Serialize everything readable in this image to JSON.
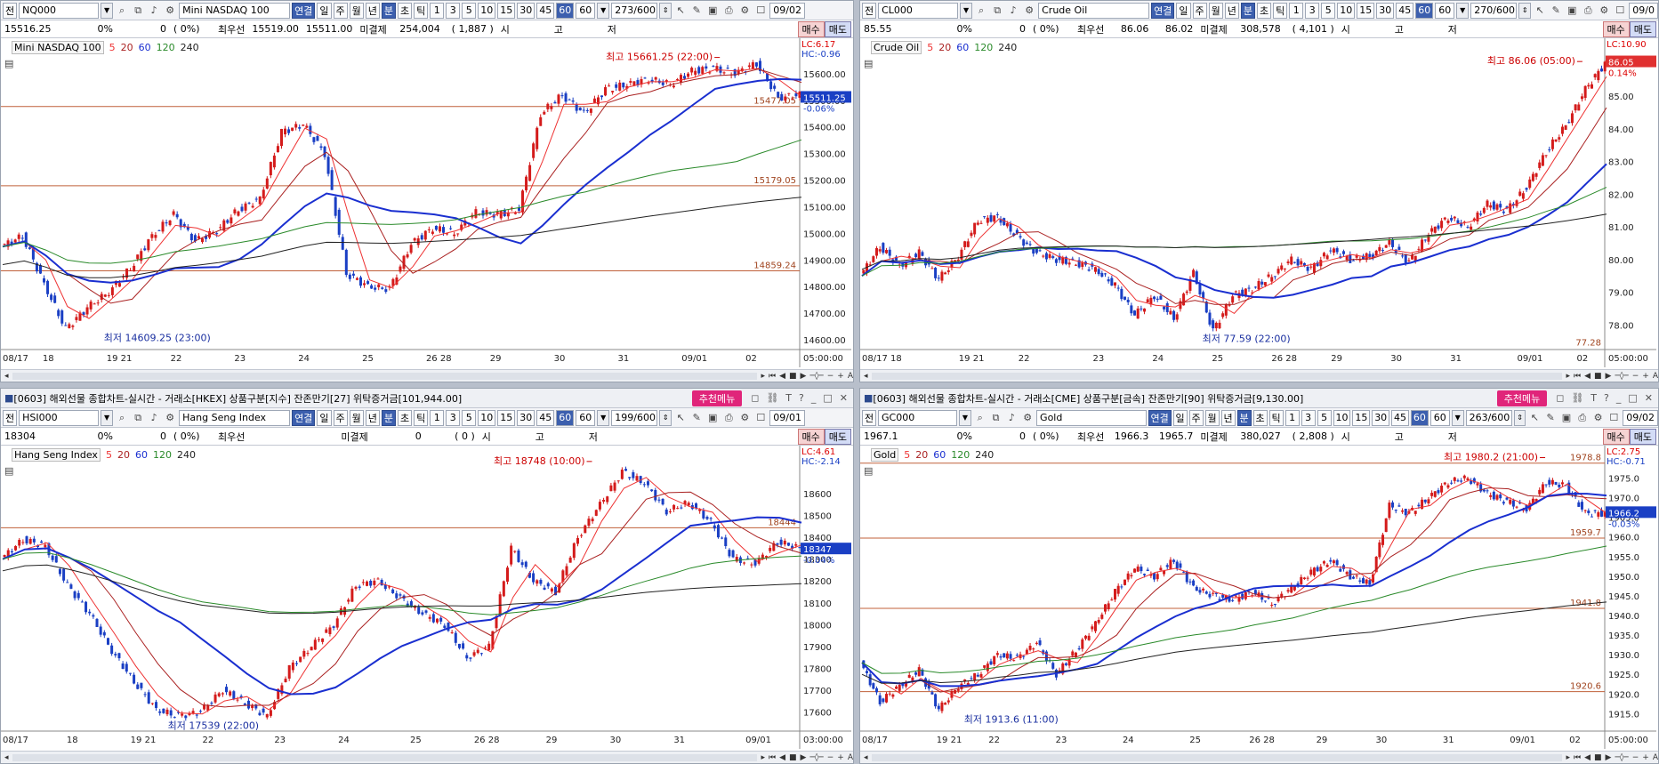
{
  "panels": [
    {
      "id": "p0",
      "has_title": false,
      "code": "NQ000",
      "name": "Mini NASDAQ 100",
      "link_label": "연결",
      "periods": [
        "일",
        "주",
        "월",
        "년",
        "분",
        "초",
        "틱"
      ],
      "active_period": "분",
      "intervals": [
        "1",
        "3",
        "5",
        "10",
        "15",
        "30",
        "45",
        "60"
      ],
      "active_interval": "60",
      "sel_interval": "60",
      "count": "273/600",
      "date": "09/02",
      "quote": {
        "last": "15516.25",
        "pct": "0%",
        "vol": "0",
        "ratio": "(    0%)",
        "best_label": "최우선",
        "bid": "15519.00",
        "ask": "15511.00",
        "oi_label": "미결제",
        "oi": "254,004",
        "oi_chg": "( 1,887 )",
        "open_label": "시",
        "high_label": "고",
        "low_label": "저"
      },
      "buy": "매수",
      "sell": "매도",
      "legend": {
        "name": "Mini NASDAQ 100",
        "mas": [
          "5",
          "20",
          "60",
          "120",
          "240"
        ]
      },
      "lc": "LC:6.17",
      "hc": "HC:-0.96",
      "price_ticks": [
        "15600.00",
        "15500.00",
        "15400.00",
        "15300.00",
        "15200.00",
        "15100.00",
        "15000.00",
        "14900.00",
        "14800.00",
        "14700.00",
        "14600.00"
      ],
      "ymin": 14570,
      "ymax": 15700,
      "levels": [
        {
          "v": 15477.05,
          "label": "15477.05"
        },
        {
          "v": 15179.05,
          "label": "15179.05"
        },
        {
          "v": 14859.24,
          "label": "14859.24"
        }
      ],
      "current": {
        "v": 15511.25,
        "label": "15511.25",
        "pct": "-0.06%"
      },
      "high": {
        "v": 15661.25,
        "label": "최고 15661.25 (22:00)",
        "pos": 0.9
      },
      "low": {
        "v": 14609.25,
        "label": "최저 14609.25 (23:00)",
        "pos": 0.12
      },
      "x_labels": [
        {
          "t": "08/17",
          "p": 0.0
        },
        {
          "t": "18",
          "p": 0.05
        },
        {
          "t": "19 21",
          "p": 0.13
        },
        {
          "t": "22",
          "p": 0.21
        },
        {
          "t": "23",
          "p": 0.29
        },
        {
          "t": "24",
          "p": 0.37
        },
        {
          "t": "25",
          "p": 0.45
        },
        {
          "t": "26 28",
          "p": 0.53
        },
        {
          "t": "29",
          "p": 0.61
        },
        {
          "t": "30",
          "p": 0.69
        },
        {
          "t": "31",
          "p": 0.77
        },
        {
          "t": "09/01",
          "p": 0.85
        },
        {
          "t": "02",
          "p": 0.93
        }
      ],
      "axis_time": "05:00:00",
      "path": [
        14950,
        14990,
        14810,
        14640,
        14720,
        14780,
        14870,
        14990,
        15070,
        14970,
        15010,
        15090,
        15130,
        15380,
        15410,
        15300,
        14850,
        14800,
        14790,
        14960,
        15020,
        15000,
        15080,
        15070,
        15090,
        15450,
        15520,
        15450,
        15540,
        15560,
        15580,
        15560,
        15610,
        15620,
        15600,
        15640,
        15510,
        15520
      ]
    },
    {
      "id": "p1",
      "has_title": false,
      "code": "CL000",
      "name": "Crude Oil",
      "link_label": "연결",
      "periods": [
        "일",
        "주",
        "월",
        "년",
        "분",
        "초",
        "틱"
      ],
      "active_period": "분",
      "intervals": [
        "1",
        "3",
        "5",
        "10",
        "15",
        "30",
        "45",
        "60"
      ],
      "active_interval": "60",
      "sel_interval": "60",
      "count": "270/600",
      "date": "09/0",
      "quote": {
        "last": "85.55",
        "pct": "0%",
        "vol": "0",
        "ratio": "(    0%)",
        "best_label": "최우선",
        "bid": "86.06",
        "ask": "86.02",
        "oi_label": "미결제",
        "oi": "308,578",
        "oi_chg": "( 4,101 )",
        "open_label": "시",
        "high_label": "고",
        "low_label": "저"
      },
      "buy": "매수",
      "sell": "매도",
      "legend": {
        "name": "Crude Oil",
        "mas": [
          "5",
          "20",
          "60",
          "120",
          "240"
        ]
      },
      "lc": "LC:10.90",
      "hc": "",
      "price_ticks": [
        "85.00",
        "84.00",
        "83.00",
        "82.00",
        "81.00",
        "80.00",
        "79.00",
        "78.00"
      ],
      "ymin": 77.3,
      "ymax": 86.5,
      "levels": [
        {
          "v": 77.28,
          "label": "77.28",
          "hidden_line": true
        }
      ],
      "current": {
        "v": 86.05,
        "label": "86.05",
        "pct": "0.14%"
      },
      "high": {
        "v": 86.06,
        "label": "최고 86.06 (05:00)",
        "pos": 0.97
      },
      "low": {
        "v": 77.59,
        "label": "최저 77.59 (22:00)",
        "pos": 0.45
      },
      "x_labels": [
        {
          "t": "08/17 18",
          "p": 0.0
        },
        {
          "t": "19 21",
          "p": 0.13
        },
        {
          "t": "22",
          "p": 0.21
        },
        {
          "t": "23",
          "p": 0.31
        },
        {
          "t": "24",
          "p": 0.39
        },
        {
          "t": "25",
          "p": 0.47
        },
        {
          "t": "26 28",
          "p": 0.55
        },
        {
          "t": "29",
          "p": 0.63
        },
        {
          "t": "30",
          "p": 0.71
        },
        {
          "t": "31",
          "p": 0.79
        },
        {
          "t": "09/01",
          "p": 0.88
        },
        {
          "t": "02",
          "p": 0.96
        }
      ],
      "axis_time": "05:00:00",
      "path": [
        79.5,
        80.4,
        79.8,
        80.2,
        79.4,
        80.1,
        81.2,
        81.3,
        80.7,
        80.2,
        80.0,
        79.9,
        79.7,
        79.2,
        78.3,
        78.9,
        78.2,
        79.6,
        77.8,
        78.9,
        79.1,
        79.5,
        80.0,
        79.7,
        80.3,
        80.0,
        80.1,
        80.5,
        79.9,
        80.8,
        81.3,
        81.0,
        81.7,
        81.5,
        82.2,
        83.3,
        84.1,
        85.2,
        86.0
      ]
    },
    {
      "id": "p2",
      "has_title": true,
      "title": "[0603] 해외선물 종합차트-실시간 - 거래소[HKEX] 상품구분[지수] 잔존만기[27] 위탁증거금[101,944.00]",
      "menu": "추천메뉴",
      "code": "HSI000",
      "name": "Hang Seng Index",
      "link_label": "연결",
      "periods": [
        "일",
        "주",
        "월",
        "년",
        "분",
        "초",
        "틱"
      ],
      "active_period": "분",
      "intervals": [
        "1",
        "3",
        "5",
        "10",
        "15",
        "30",
        "45",
        "60"
      ],
      "active_interval": "60",
      "sel_interval": "60",
      "count": "199/600",
      "date": "09/01",
      "quote": {
        "last": "18304",
        "pct": "0%",
        "vol": "0",
        "ratio": "(    0%)",
        "best_label": "최우선",
        "bid": "",
        "ask": "",
        "oi_label": "미결제",
        "oi": "0",
        "oi_chg": "(  0  )",
        "open_label": "시",
        "high_label": "고",
        "low_label": "저"
      },
      "buy": "매수",
      "sell": "매도",
      "legend": {
        "name": "Hang Seng Index",
        "mas": [
          "5",
          "20",
          "60",
          "120",
          "240"
        ]
      },
      "lc": "LC:4.61",
      "hc": "HC:-2.14",
      "price_ticks": [
        "18600",
        "18500",
        "18400",
        "18300",
        "18200",
        "18100",
        "18000",
        "17900",
        "17800",
        "17700",
        "17600"
      ],
      "ymin": 17520,
      "ymax": 18780,
      "levels": [
        {
          "v": 18444,
          "label": "18444"
        }
      ],
      "current": {
        "v": 18347,
        "label": "18347",
        "pct": "-0.04%"
      },
      "high": {
        "v": 18748,
        "label": "최고 18748 (10:00)",
        "pos": 0.74
      },
      "low": {
        "v": 17539,
        "label": "최저 17539 (22:00)",
        "pos": 0.2
      },
      "x_labels": [
        {
          "t": "08/17",
          "p": 0.0
        },
        {
          "t": "18",
          "p": 0.08
        },
        {
          "t": "19 21",
          "p": 0.16
        },
        {
          "t": "22",
          "p": 0.25
        },
        {
          "t": "23",
          "p": 0.34
        },
        {
          "t": "24",
          "p": 0.42
        },
        {
          "t": "25",
          "p": 0.51
        },
        {
          "t": "26 28",
          "p": 0.59
        },
        {
          "t": "29",
          "p": 0.68
        },
        {
          "t": "30",
          "p": 0.76
        },
        {
          "t": "31",
          "p": 0.84
        },
        {
          "t": "09/01",
          "p": 0.93
        }
      ],
      "axis_time": "03:00:00",
      "path": [
        18300,
        18390,
        18360,
        18180,
        18050,
        17880,
        17740,
        17610,
        17580,
        17600,
        17700,
        17640,
        17580,
        17800,
        17900,
        18000,
        18180,
        18200,
        18120,
        18050,
        18000,
        17850,
        17900,
        18350,
        18200,
        18150,
        18400,
        18550,
        18700,
        18650,
        18520,
        18560,
        18470,
        18300,
        18280,
        18380,
        18350
      ]
    },
    {
      "id": "p3",
      "has_title": true,
      "title": "[0603] 해외선물 종합차트-실시간 - 거래소[CME] 상품구분[금속] 잔존만기[90] 위탁증거금[9,130.00]",
      "menu": "추천메뉴",
      "code": "GC000",
      "name": "Gold",
      "link_label": "연결",
      "periods": [
        "일",
        "주",
        "월",
        "년",
        "분",
        "초",
        "틱"
      ],
      "active_period": "분",
      "intervals": [
        "1",
        "3",
        "5",
        "10",
        "15",
        "30",
        "45",
        "60"
      ],
      "active_interval": "60",
      "sel_interval": "60",
      "count": "263/600",
      "date": "09/02",
      "quote": {
        "last": "1967.1",
        "pct": "0%",
        "vol": "0",
        "ratio": "(    0%)",
        "best_label": "최우선",
        "bid": "1966.3",
        "ask": "1965.7",
        "oi_label": "미결제",
        "oi": "380,027",
        "oi_chg": "( 2,808 )",
        "open_label": "시",
        "high_label": "고",
        "low_label": "저"
      },
      "buy": "매수",
      "sell": "매도",
      "legend": {
        "name": "Gold",
        "mas": [
          "5",
          "20",
          "60",
          "120",
          "240"
        ]
      },
      "lc": "LC:2.75",
      "hc": "HC:-0.71",
      "price_ticks": [
        "1975.0",
        "1970.0",
        "1965.0",
        "1960.0",
        "1955.0",
        "1950.0",
        "1945.0",
        "1940.0",
        "1935.0",
        "1930.0",
        "1925.0",
        "1920.0",
        "1915.0"
      ],
      "ymin": 1911,
      "ymax": 1981,
      "levels": [
        {
          "v": 1978.8,
          "label": "1978.8"
        },
        {
          "v": 1959.7,
          "label": "1959.7"
        },
        {
          "v": 1941.8,
          "label": "1941.8"
        },
        {
          "v": 1920.6,
          "label": "1920.6"
        }
      ],
      "current": {
        "v": 1966.2,
        "label": "1966.2",
        "pct": "-0.03%"
      },
      "high": {
        "v": 1980.2,
        "label": "최고 1980.2 (21:00)",
        "pos": 0.92
      },
      "low": {
        "v": 1913.6,
        "label": "최저 1913.6 (11:00)",
        "pos": 0.13
      },
      "x_labels": [
        {
          "t": "08/17",
          "p": 0.0
        },
        {
          "t": "19 21",
          "p": 0.1
        },
        {
          "t": "22",
          "p": 0.17
        },
        {
          "t": "23",
          "p": 0.26
        },
        {
          "t": "24",
          "p": 0.35
        },
        {
          "t": "25",
          "p": 0.44
        },
        {
          "t": "26 28",
          "p": 0.52
        },
        {
          "t": "29",
          "p": 0.61
        },
        {
          "t": "30",
          "p": 0.69
        },
        {
          "t": "31",
          "p": 0.78
        },
        {
          "t": "09/01",
          "p": 0.87
        },
        {
          "t": "02",
          "p": 0.95
        }
      ],
      "axis_time": "05:00:00",
      "path": [
        1928,
        1918,
        1922,
        1926,
        1916,
        1922,
        1925,
        1930,
        1929,
        1933,
        1925,
        1931,
        1938,
        1946,
        1952,
        1950,
        1954,
        1947,
        1945,
        1944,
        1946,
        1943,
        1947,
        1951,
        1954,
        1950,
        1948,
        1968,
        1966,
        1970,
        1974,
        1975,
        1971,
        1969,
        1967,
        1974,
        1973,
        1966,
        1966
      ]
    }
  ]
}
